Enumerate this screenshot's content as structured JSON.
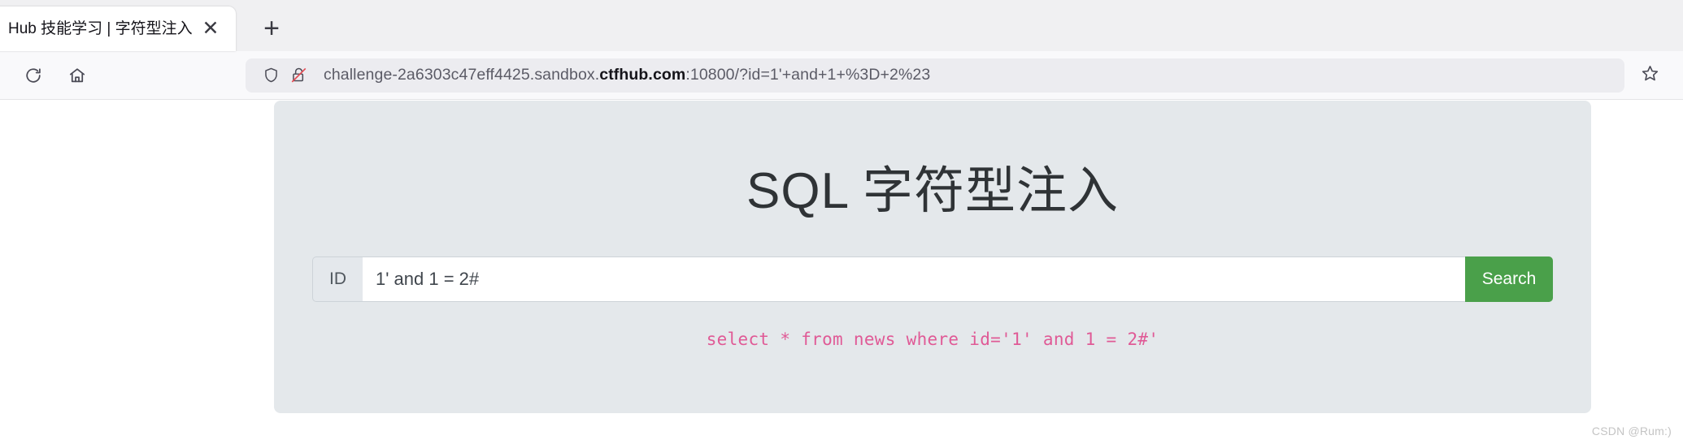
{
  "browser": {
    "tab": {
      "title": "Hub 技能学习 | 字符型注入",
      "close_label": "✕"
    },
    "new_tab_label": "+",
    "toolbar": {
      "reload_icon": "reload-icon",
      "home_icon": "home-icon",
      "shield_icon": "shield-icon",
      "insecure_lock_icon": "lock-slashed-icon",
      "bookmark_icon": "star-icon"
    },
    "url": {
      "prefix": "challenge-2a6303c47eff4425.sandbox.",
      "host": "ctfhub.com",
      "suffix": ":10800/?id=1'+and+1+%3D+2%23",
      "full": "challenge-2a6303c47eff4425.sandbox.ctfhub.com:10800/?id=1'+and+1+%3D+2%23"
    }
  },
  "page": {
    "title": "SQL 字符型注入",
    "form": {
      "prefix_label": "ID",
      "input_value": "1' and 1 = 2#",
      "input_placeholder": "",
      "submit_label": "Search"
    },
    "sql_query": "select * from news where id='1' and 1 = 2#'",
    "colors": {
      "panel_bg": "#e4e8eb",
      "button_green": "#4aa04a",
      "sql_pink": "#e05a96",
      "title_gray": "#2f3336"
    }
  },
  "watermark": "CSDN @Rum:)"
}
